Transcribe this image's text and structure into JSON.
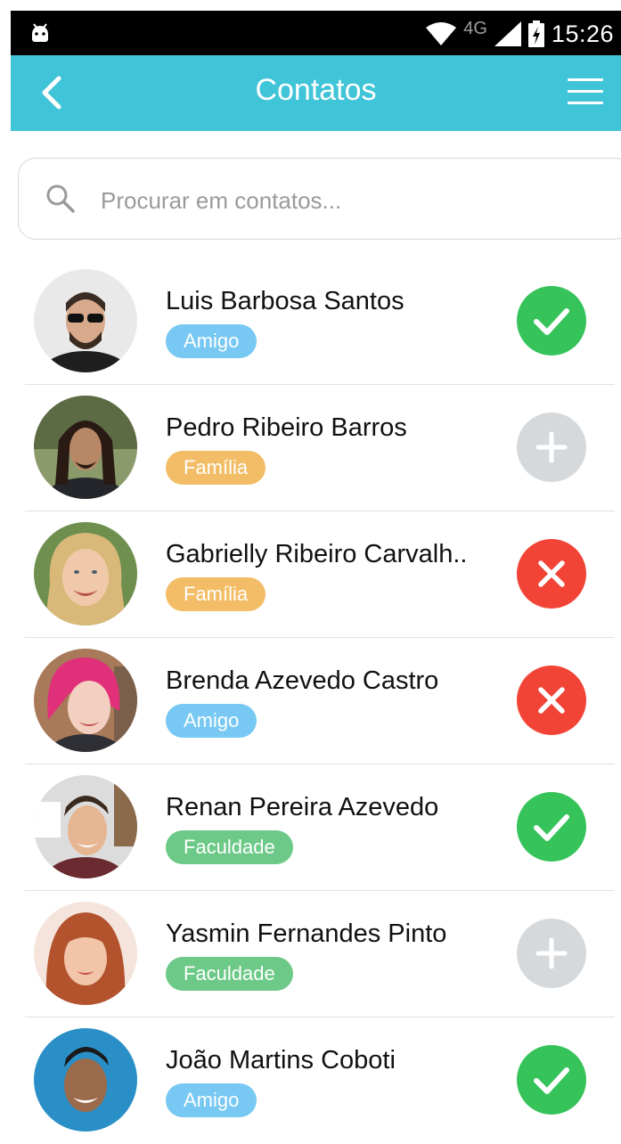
{
  "status_bar": {
    "network": "4G",
    "time": "15:26"
  },
  "app_bar": {
    "title": "Contatos",
    "back_icon": "chevron-left-icon",
    "menu_icon": "hamburger-menu-icon",
    "color": "#40c4d8"
  },
  "search": {
    "placeholder": "Procurar em contatos...",
    "value": "",
    "icon": "search-icon"
  },
  "colors": {
    "tag_amigo": "#77c8f2",
    "tag_familia": "#f2bd66",
    "tag_faculdade": "#6cc987",
    "action_added": "#35c35a",
    "action_add": "#d5d9dc",
    "action_remove": "#f24436"
  },
  "contacts": [
    {
      "name": "Luis Barbosa Santos",
      "tag": "Amigo",
      "action": "added"
    },
    {
      "name": "Pedro Ribeiro Barros",
      "tag": "Família",
      "action": "add"
    },
    {
      "name": "Gabrielly Ribeiro Carvalh..",
      "tag": "Família",
      "action": "remove"
    },
    {
      "name": "Brenda Azevedo Castro",
      "tag": "Amigo",
      "action": "remove"
    },
    {
      "name": "Renan Pereira Azevedo",
      "tag": "Faculdade",
      "action": "added"
    },
    {
      "name": "Yasmin Fernandes Pinto",
      "tag": "Faculdade",
      "action": "add"
    },
    {
      "name": "João Martins Coboti",
      "tag": "Amigo",
      "action": "added"
    }
  ]
}
